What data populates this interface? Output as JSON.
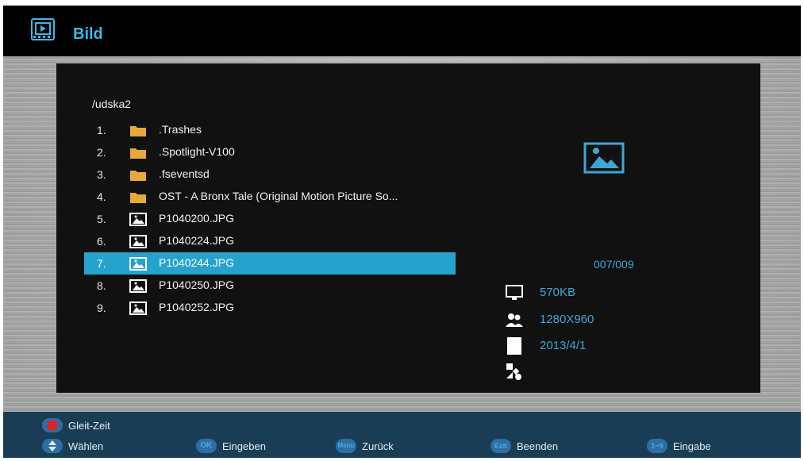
{
  "header": {
    "title": "Bild",
    "icon": "film-icon"
  },
  "browser": {
    "path": "/udska2",
    "selected_index": 6,
    "items": [
      {
        "num": "1.",
        "name": ".Trashes",
        "type": "folder"
      },
      {
        "num": "2.",
        "name": ".Spotlight-V100",
        "type": "folder"
      },
      {
        "num": "3.",
        "name": ".fseventsd",
        "type": "folder"
      },
      {
        "num": "4.",
        "name": "OST - A Bronx Tale (Original Motion Picture So...",
        "type": "folder"
      },
      {
        "num": "5.",
        "name": "P1040200.JPG",
        "type": "image"
      },
      {
        "num": "6.",
        "name": "P1040224.JPG",
        "type": "image"
      },
      {
        "num": "7.",
        "name": "P1040244.JPG",
        "type": "image"
      },
      {
        "num": "8.",
        "name": "P1040250.JPG",
        "type": "image"
      },
      {
        "num": "9.",
        "name": "P1040252.JPG",
        "type": "image"
      }
    ]
  },
  "info": {
    "counter": "007/009",
    "size": "570KB",
    "resolution": "1280X960",
    "date": "2013/4/1",
    "extra": ""
  },
  "footer": {
    "slideshow_label": "Gleit-Zeit",
    "buttons": [
      {
        "key": "",
        "label": "Wählen"
      },
      {
        "key": "OK",
        "label": "Eingeben"
      },
      {
        "key": "Menu",
        "label": "Zurück"
      },
      {
        "key": "Exit",
        "label": "Beenden"
      },
      {
        "key": "1~9",
        "label": "Eingabe"
      }
    ]
  },
  "colors": {
    "accent": "#3fb6e4",
    "selection": "#26a3cc",
    "folder": "#e8a93a",
    "footer": "#1a3d56"
  }
}
